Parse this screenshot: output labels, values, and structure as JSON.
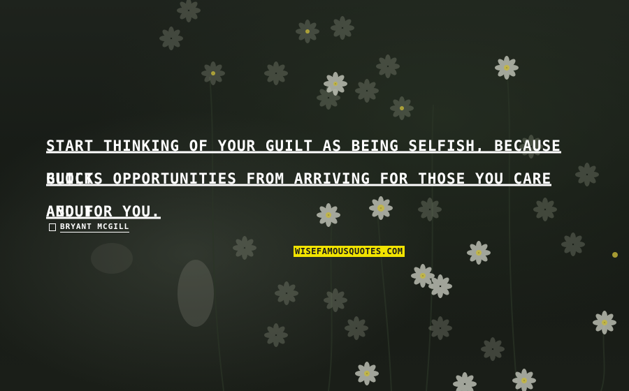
{
  "quote": {
    "lines": [
      "START THINKING OF YOUR GUILT AS BEING SELFISH, BECAUSE GUILT",
      "BLOCKS OPPORTUNITIES FROM ARRIVING FOR THOSE YOU CARE ABOUT",
      "AND FOR YOU."
    ]
  },
  "author": {
    "name": "BRYANT MCGILL"
  },
  "watermark": {
    "text": "WISEFAMOUSQUOTES.COM",
    "color": "#f1e300"
  },
  "background": {
    "description_icon": "daisy-flower-field",
    "tone": "#1b1f1a"
  }
}
